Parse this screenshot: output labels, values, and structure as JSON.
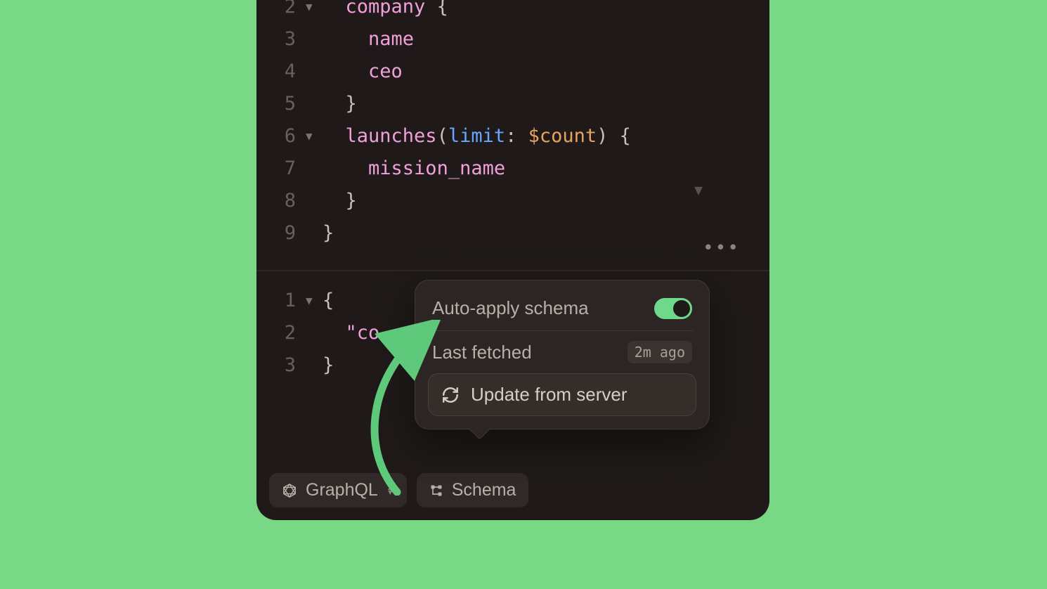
{
  "editor": {
    "lines": [
      {
        "num": "2",
        "fold": "▼",
        "indent": "  ",
        "tokens": [
          {
            "t": "company",
            "c": "pink"
          },
          {
            "t": " {",
            "c": "plain"
          }
        ]
      },
      {
        "num": "3",
        "fold": "",
        "indent": "    ",
        "tokens": [
          {
            "t": "name",
            "c": "pink"
          }
        ]
      },
      {
        "num": "4",
        "fold": "",
        "indent": "    ",
        "tokens": [
          {
            "t": "ceo",
            "c": "pink"
          }
        ]
      },
      {
        "num": "5",
        "fold": "",
        "indent": "  ",
        "tokens": [
          {
            "t": "}",
            "c": "plain"
          }
        ]
      },
      {
        "num": "6",
        "fold": "▼",
        "indent": "  ",
        "tokens": [
          {
            "t": "launches",
            "c": "pink"
          },
          {
            "t": "(",
            "c": "plain"
          },
          {
            "t": "limit",
            "c": "blue"
          },
          {
            "t": ": ",
            "c": "plain"
          },
          {
            "t": "$count",
            "c": "orange"
          },
          {
            "t": ") {",
            "c": "plain"
          }
        ]
      },
      {
        "num": "7",
        "fold": "",
        "indent": "    ",
        "tokens": [
          {
            "t": "mission_name",
            "c": "pink"
          }
        ]
      },
      {
        "num": "8",
        "fold": "",
        "indent": "  ",
        "tokens": [
          {
            "t": "}",
            "c": "plain"
          }
        ]
      },
      {
        "num": "9",
        "fold": "",
        "indent": "",
        "tokens": [
          {
            "t": "}",
            "c": "plain"
          }
        ]
      }
    ]
  },
  "vars": {
    "lines": [
      {
        "num": "1",
        "fold": "▼",
        "indent": "",
        "tokens": [
          {
            "t": "{",
            "c": "plain"
          }
        ]
      },
      {
        "num": "2",
        "fold": "",
        "indent": "  ",
        "tokens": [
          {
            "t": "\"co",
            "c": "pink"
          }
        ]
      },
      {
        "num": "3",
        "fold": "",
        "indent": "",
        "tokens": [
          {
            "t": "}",
            "c": "plain"
          }
        ]
      }
    ]
  },
  "bottombar": {
    "graphql_label": "GraphQL",
    "schema_label": "Schema"
  },
  "popover": {
    "auto_apply_label": "Auto-apply schema",
    "auto_apply_on": true,
    "last_fetched_label": "Last fetched",
    "last_fetched_value": "2m ago",
    "update_label": "Update from server"
  }
}
